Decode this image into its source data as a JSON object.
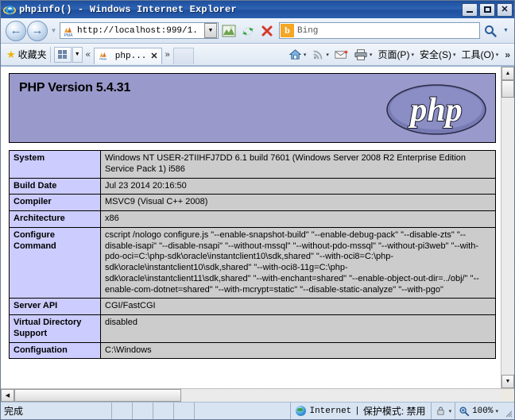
{
  "window": {
    "title": "phpinfo() - Windows Internet Explorer",
    "ie_icon": "ie-logo-icon",
    "minimize_label": "_",
    "maximize_label": "□",
    "close_label": "✕"
  },
  "address_bar": {
    "back_icon": "back-arrow-icon",
    "forward_icon": "forward-arrow-icon",
    "recent_pages_icon": "chevron-down-icon",
    "site_icon": "pma-favicon-icon",
    "url": "http://localhost:999/1.",
    "url_dropdown_icon": "chevron-down-icon",
    "compat_view_icon": "compatibility-view-icon",
    "refresh_icon": "refresh-icon",
    "stop_icon": "stop-icon",
    "search_engine_icon": "bing-icon",
    "search_engine_label": "b",
    "search_placeholder": "Bing",
    "search_go_icon": "search-icon",
    "search_options_icon": "chevron-down-icon"
  },
  "command_bar": {
    "favorites_icon": "star-icon",
    "favorites_label": "收藏夹",
    "favorites_bar_icon": "grid-icon",
    "favorites_bar_dropdown_icon": "chevron-down-icon",
    "tabs_scroll_left_icon": "double-chevron-left-icon",
    "tabs_scroll_right_icon": "double-chevron-right-icon",
    "tabs": [
      {
        "icon": "pma-favicon-icon",
        "label": "php...",
        "close_label": "✕"
      }
    ],
    "home_icon": "home-icon",
    "home_caret": "▾",
    "feeds_icon": "rss-icon",
    "feeds_caret": "▾",
    "mail_icon": "mail-icon",
    "print_icon": "printer-icon",
    "print_caret": "▾",
    "menu_items": [
      {
        "label": "页面(P)",
        "caret": "▾"
      },
      {
        "label": "安全(S)",
        "caret": "▾"
      },
      {
        "label": "工具(O)",
        "caret": "▾"
      }
    ],
    "overflow_label": "»"
  },
  "page": {
    "banner": {
      "version_text": "PHP Version 5.4.31",
      "logo_text": "php",
      "background_color": "#9999cc"
    },
    "table": {
      "header_cell_color": "#ccccff",
      "value_cell_color": "#cccccc",
      "rows": [
        {
          "key": "System",
          "value": "Windows NT USER-2TIIHFJ7DD 6.1 build 7601 (Windows Server 2008 R2 Enterprise Edition Service Pack 1) i586"
        },
        {
          "key": "Build Date",
          "value": "Jul 23 2014 20:16:50"
        },
        {
          "key": "Compiler",
          "value": "MSVC9 (Visual C++ 2008)"
        },
        {
          "key": "Architecture",
          "value": "x86"
        },
        {
          "key": "Configure Command",
          "value": "cscript /nologo configure.js \"--enable-snapshot-build\" \"--enable-debug-pack\" \"--disable-zts\" \"--disable-isapi\" \"--disable-nsapi\" \"--without-mssql\" \"--without-pdo-mssql\" \"--without-pi3web\" \"--with-pdo-oci=C:\\php-sdk\\oracle\\instantclient10\\sdk,shared\" \"--with-oci8=C:\\php-sdk\\oracle\\instantclient10\\sdk,shared\" \"--with-oci8-11g=C:\\php-sdk\\oracle\\instantclient11\\sdk,shared\" \"--with-enchant=shared\" \"--enable-object-out-dir=../obj/\" \"--enable-com-dotnet=shared\" \"--with-mcrypt=static\" \"--disable-static-analyze\" \"--with-pgo\""
        },
        {
          "key": "Server API",
          "value": "CGI/FastCGI"
        },
        {
          "key": "Virtual Directory Support",
          "value": "disabled"
        },
        {
          "key": "Configuation",
          "value": "C:\\Windows"
        }
      ]
    },
    "vertical_scrollbar": {
      "up_icon": "scroll-up-icon",
      "down_icon": "scroll-down-icon"
    },
    "horizontal_scrollbar": {
      "left_icon": "scroll-left-icon",
      "right_icon": "scroll-right-icon"
    }
  },
  "status_bar": {
    "status_text": "完成",
    "zone_icon": "internet-zone-icon",
    "zone_label": "Internet",
    "separator": "|",
    "protected_mode": "保护模式: 禁用",
    "privacy_icon": "privacy-lock-icon",
    "privacy_caret": "▾",
    "zoom_icon": "zoom-magnifier-icon",
    "zoom_level": "100%",
    "zoom_caret": "▾",
    "resize_grip_icon": "resize-grip-icon"
  }
}
